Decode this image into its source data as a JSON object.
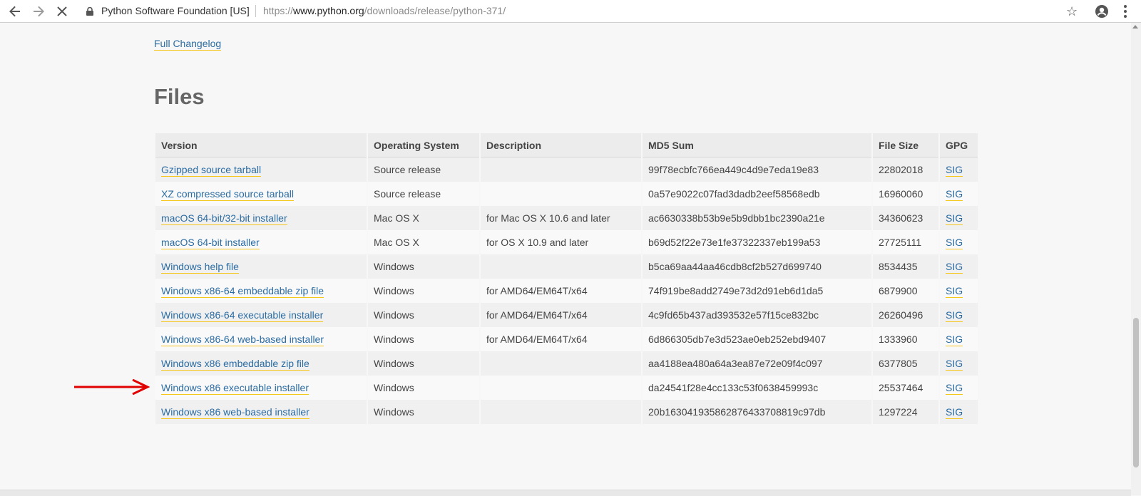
{
  "browser": {
    "origin": "Python Software Foundation [US]",
    "url_prefix": "https://",
    "url_host": "www.python.org",
    "url_path": "/downloads/release/python-371/"
  },
  "changelog_link": "Full Changelog",
  "files_heading": "Files",
  "table": {
    "headers": [
      "Version",
      "Operating System",
      "Description",
      "MD5 Sum",
      "File Size",
      "GPG"
    ],
    "rows": [
      {
        "version": "Gzipped source tarball",
        "os": "Source release",
        "description": "",
        "md5": "99f78ecbfc766ea449c4d9e7eda19e83",
        "size": "22802018",
        "gpg": "SIG"
      },
      {
        "version": "XZ compressed source tarball",
        "os": "Source release",
        "description": "",
        "md5": "0a57e9022c07fad3dadb2eef58568edb",
        "size": "16960060",
        "gpg": "SIG"
      },
      {
        "version": "macOS 64-bit/32-bit installer",
        "os": "Mac OS X",
        "description": "for Mac OS X 10.6 and later",
        "md5": "ac6630338b53b9e5b9dbb1bc2390a21e",
        "size": "34360623",
        "gpg": "SIG"
      },
      {
        "version": "macOS 64-bit installer",
        "os": "Mac OS X",
        "description": "for OS X 10.9 and later",
        "md5": "b69d52f22e73e1fe37322337eb199a53",
        "size": "27725111",
        "gpg": "SIG"
      },
      {
        "version": "Windows help file",
        "os": "Windows",
        "description": "",
        "md5": "b5ca69aa44aa46cdb8cf2b527d699740",
        "size": "8534435",
        "gpg": "SIG"
      },
      {
        "version": "Windows x86-64 embeddable zip file",
        "os": "Windows",
        "description": "for AMD64/EM64T/x64",
        "md5": "74f919be8add2749e73d2d91eb6d1da5",
        "size": "6879900",
        "gpg": "SIG"
      },
      {
        "version": "Windows x86-64 executable installer",
        "os": "Windows",
        "description": "for AMD64/EM64T/x64",
        "md5": "4c9fd65b437ad393532e57f15ce832bc",
        "size": "26260496",
        "gpg": "SIG"
      },
      {
        "version": "Windows x86-64 web-based installer",
        "os": "Windows",
        "description": "for AMD64/EM64T/x64",
        "md5": "6d866305db7e3d523ae0eb252ebd9407",
        "size": "1333960",
        "gpg": "SIG"
      },
      {
        "version": "Windows x86 embeddable zip file",
        "os": "Windows",
        "description": "",
        "md5": "aa4188ea480a64a3ea87e72e09f4c097",
        "size": "6377805",
        "gpg": "SIG"
      },
      {
        "version": "Windows x86 executable installer",
        "os": "Windows",
        "description": "",
        "md5": "da24541f28e4cc133c53f0638459993c",
        "size": "25537464",
        "gpg": "SIG"
      },
      {
        "version": "Windows x86 web-based installer",
        "os": "Windows",
        "description": "",
        "md5": "20b163041935862876433708819c97db",
        "size": "1297224",
        "gpg": "SIG"
      }
    ]
  },
  "colors": {
    "link": "#2b6ca3",
    "link_underline": "#f5c518",
    "arrow": "#e00000"
  },
  "icons": [
    "back-arrow-icon",
    "forward-arrow-icon",
    "stop-loading-icon",
    "lock-icon",
    "star-icon",
    "account-icon",
    "menu-icon",
    "red-arrow-icon"
  ]
}
